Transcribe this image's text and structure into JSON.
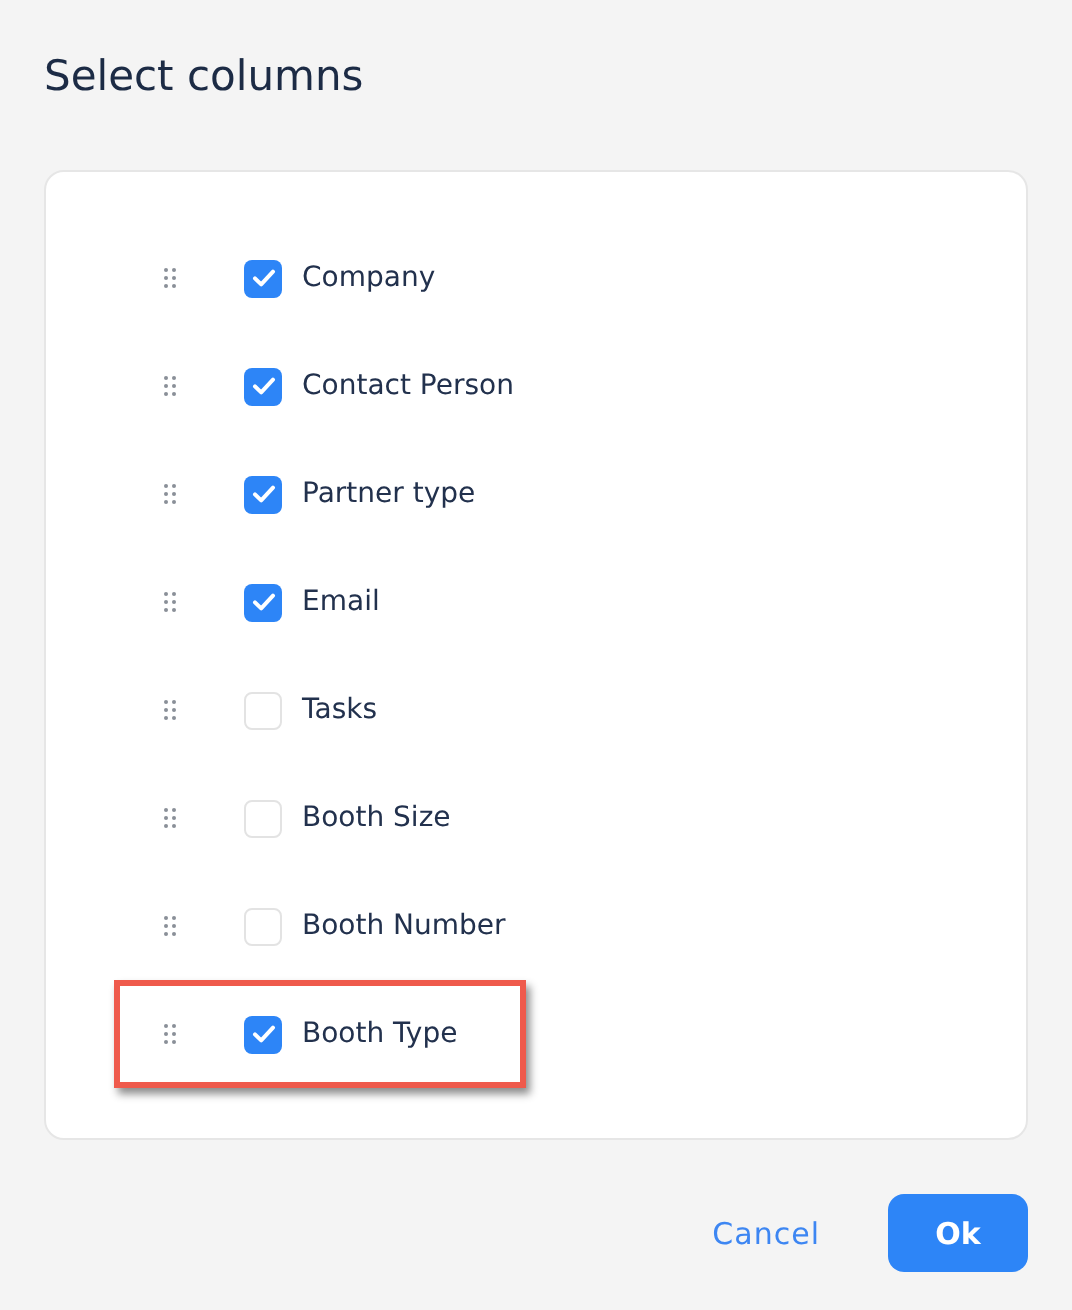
{
  "title": "Select columns",
  "columns": [
    {
      "label": "Company",
      "checked": true,
      "highlighted": false
    },
    {
      "label": "Contact Person",
      "checked": true,
      "highlighted": false
    },
    {
      "label": "Partner type",
      "checked": true,
      "highlighted": false
    },
    {
      "label": "Email",
      "checked": true,
      "highlighted": false
    },
    {
      "label": "Tasks",
      "checked": false,
      "highlighted": false
    },
    {
      "label": "Booth Size",
      "checked": false,
      "highlighted": false
    },
    {
      "label": "Booth Number",
      "checked": false,
      "highlighted": false
    },
    {
      "label": "Booth Type",
      "checked": true,
      "highlighted": true
    }
  ],
  "buttons": {
    "cancel": "Cancel",
    "ok": "Ok"
  }
}
